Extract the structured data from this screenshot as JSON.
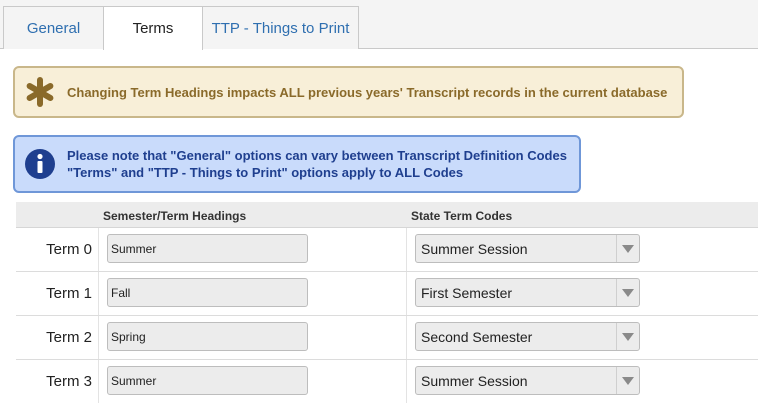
{
  "tabs": [
    {
      "label": "General"
    },
    {
      "label": "Terms"
    },
    {
      "label": "TTP - Things to Print"
    }
  ],
  "alerts": {
    "warning": {
      "icon": "asterisk-icon",
      "text": "Changing Term Headings impacts ALL previous years' Transcript records in the current database"
    },
    "info": {
      "icon": "info-icon",
      "line1": "Please note that \"General\" options can vary between Transcript Definition Codes",
      "line2": "\"Terms\" and \"TTP - Things to Print\" options apply to ALL Codes"
    }
  },
  "grid": {
    "headers": {
      "heading": "Semester/Term Headings",
      "state_code": "State Term Codes"
    },
    "rows": [
      {
        "label": "Term 0",
        "heading": "Summer",
        "state_code": "Summer Session"
      },
      {
        "label": "Term 1",
        "heading": "Fall",
        "state_code": "First Semester"
      },
      {
        "label": "Term 2",
        "heading": "Spring",
        "state_code": "Second Semester"
      },
      {
        "label": "Term 3",
        "heading": "Summer",
        "state_code": "Summer Session"
      }
    ]
  },
  "colors": {
    "warning_icon": "#8a6a2a",
    "info_icon": "#1f3f8f"
  }
}
